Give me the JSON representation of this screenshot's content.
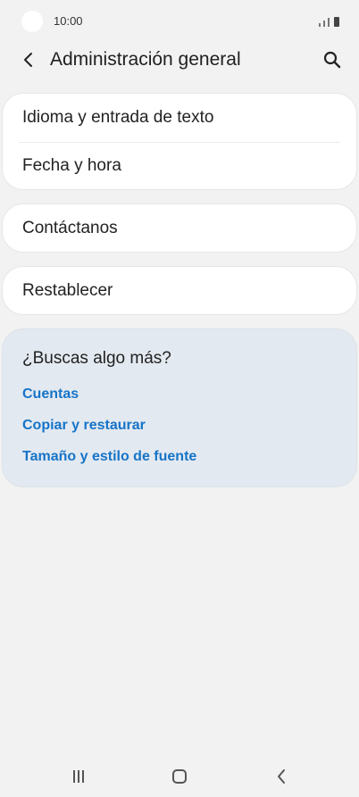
{
  "status_bar": {
    "time": "10:00"
  },
  "header": {
    "title": "Administración general"
  },
  "settings": {
    "group1": [
      "Idioma y entrada de texto",
      "Fecha y hora"
    ],
    "group2": [
      "Contáctanos"
    ],
    "group3": [
      "Restablecer"
    ]
  },
  "more": {
    "title": "¿Buscas algo más?",
    "links": [
      "Cuentas",
      "Copiar y restaurar",
      "Tamaño y estilo de fuente"
    ]
  },
  "icons": {
    "back": "chevron-left-icon",
    "search": "search-icon",
    "nav_recent": "recent-apps-icon",
    "nav_home": "home-icon",
    "nav_back": "back-icon"
  },
  "colors": {
    "link": "#1674c8",
    "background": "#f2f2f2",
    "more_card": "#e3e9f0"
  }
}
